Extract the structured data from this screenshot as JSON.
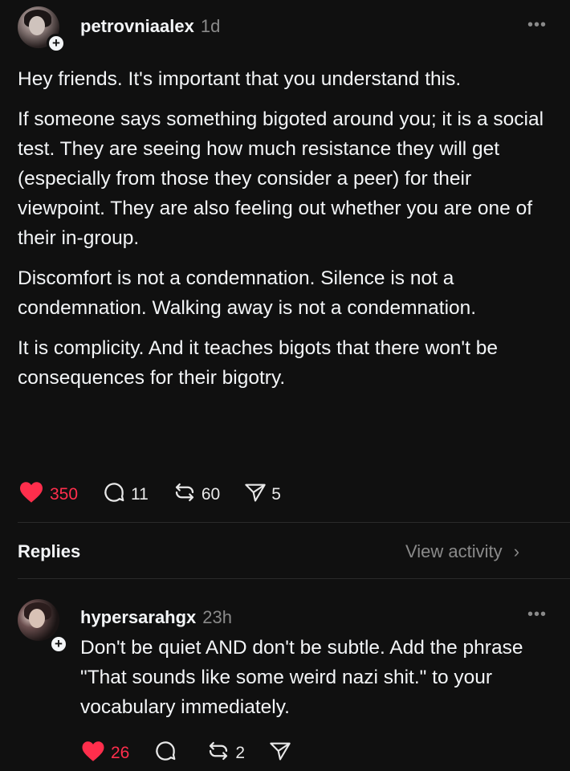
{
  "post": {
    "username": "petrovniaalex",
    "time": "1d",
    "paragraphs": [
      "Hey friends. It's important that you understand this.",
      "If someone says something bigoted around you; it is a social test. They are seeing how much resistance they will get (especially from those they consider a peer) for their viewpoint. They are also feeling out whether you are one of their in-group.",
      "Discomfort is not a condemnation. Silence is not a condemnation. Walking away is not a condemnation.",
      "It is complicity. And it teaches bigots that there won't be consequences for their bigotry."
    ],
    "likes": "350",
    "comments": "11",
    "reposts": "60",
    "shares": "5"
  },
  "replies_section": {
    "label": "Replies",
    "view_activity": "View activity"
  },
  "reply": {
    "username": "hypersarahgx",
    "time": "23h",
    "text": "Don't be quiet AND don't be subtle. Add the phrase \"That sounds like some weird nazi shit.\" to your vocabulary immediately.",
    "likes": "26",
    "reposts": "2"
  },
  "icons": {
    "heart": "heart-icon",
    "comment": "comment-icon",
    "repost": "repost-icon",
    "share": "share-icon",
    "more": "more-icon",
    "follow": "follow-plus-icon",
    "chevron": "chevron-right-icon"
  },
  "colors": {
    "background": "#101010",
    "text": "#f3f5f7",
    "muted": "#8a8a8a",
    "like": "#ff2e4c"
  }
}
